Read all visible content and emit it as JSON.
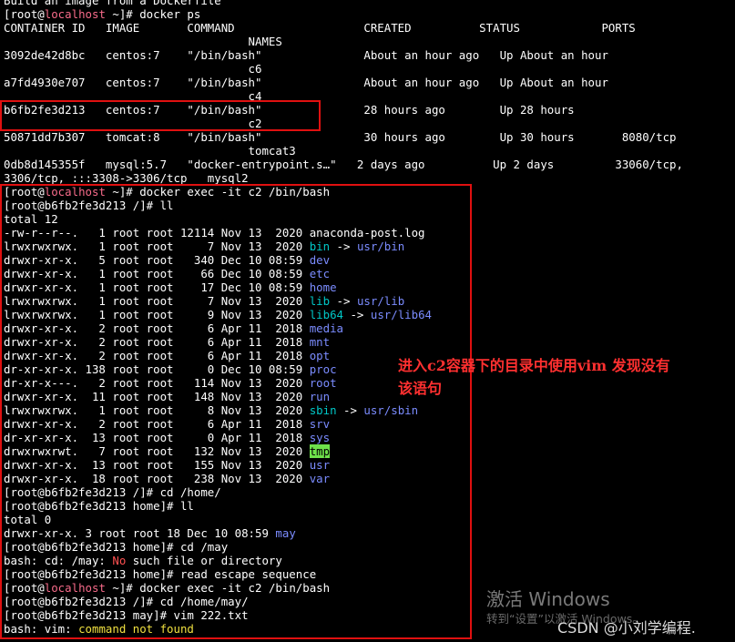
{
  "terminal": {
    "lines": [
      [
        {
          "t": "Build an image from a Dockerfile"
        }
      ],
      [
        {
          "t": "[root@"
        },
        {
          "t": "localhost",
          "c": "host"
        },
        {
          "t": " ~]# docker ps"
        }
      ],
      [
        {
          "t": "CONTAINER ID   IMAGE       COMMAND                   CREATED          STATUS            PORTS"
        }
      ],
      [
        {
          "t": "                                    NAMES"
        }
      ],
      [
        {
          "t": "3092de42d8bc   centos:7    \"/bin/bash\"               About an hour ago   Up About an hour"
        }
      ],
      [
        {
          "t": "                                    c6"
        }
      ],
      [
        {
          "t": "a7fd4930e707   centos:7    \"/bin/bash\"               About an hour ago   Up About an hour"
        }
      ],
      [
        {
          "t": "                                    c4"
        }
      ],
      [
        {
          "t": "b6fb2fe3d213   centos:7    \"/bin/bash\"               28 hours ago        Up 28 hours"
        }
      ],
      [
        {
          "t": "                                    c2"
        }
      ],
      [
        {
          "t": "50871dd7b307   tomcat:8    \"/bin/bash\"               30 hours ago        Up 30 hours       8080/tcp"
        }
      ],
      [
        {
          "t": "                                    tomcat3"
        }
      ],
      [
        {
          "t": "0db8d145355f   mysql:5.7   \"docker-entrypoint.s…\"   2 days ago          Up 2 days         33060/tcp,"
        }
      ],
      [
        {
          "t": "3306/tcp, :::3308->3306/tcp   mysql2"
        }
      ],
      [
        {
          "t": "[root@"
        },
        {
          "t": "localhost",
          "c": "host"
        },
        {
          "t": " ~]# docker exec -it c2 /bin/bash"
        }
      ],
      [
        {
          "t": "[root@b6fb2fe3d213 /]# ll"
        }
      ],
      [
        {
          "t": "total 12"
        }
      ],
      [
        {
          "t": "-rw-r--r--.   1 root root 12114 Nov 13  2020 anaconda-post.log"
        }
      ],
      [
        {
          "t": "lrwxrwxrwx.   1 root root     7 Nov 13  2020 "
        },
        {
          "t": "bin",
          "c": "link"
        },
        {
          "t": " -> "
        },
        {
          "t": "usr/bin",
          "c": "dir"
        }
      ],
      [
        {
          "t": "drwxr-xr-x.   5 root root   340 Dec 10 08:59 "
        },
        {
          "t": "dev",
          "c": "dir"
        }
      ],
      [
        {
          "t": "drwxr-xr-x.   1 root root    66 Dec 10 08:59 "
        },
        {
          "t": "etc",
          "c": "dir"
        }
      ],
      [
        {
          "t": "drwxr-xr-x.   1 root root    17 Dec 10 08:59 "
        },
        {
          "t": "home",
          "c": "dir"
        }
      ],
      [
        {
          "t": "lrwxrwxrwx.   1 root root     7 Nov 13  2020 "
        },
        {
          "t": "lib",
          "c": "link"
        },
        {
          "t": " -> "
        },
        {
          "t": "usr/lib",
          "c": "dir"
        }
      ],
      [
        {
          "t": "lrwxrwxrwx.   1 root root     9 Nov 13  2020 "
        },
        {
          "t": "lib64",
          "c": "link"
        },
        {
          "t": " -> "
        },
        {
          "t": "usr/lib64",
          "c": "dir"
        }
      ],
      [
        {
          "t": "drwxr-xr-x.   2 root root     6 Apr 11  2018 "
        },
        {
          "t": "media",
          "c": "dir"
        }
      ],
      [
        {
          "t": "drwxr-xr-x.   2 root root     6 Apr 11  2018 "
        },
        {
          "t": "mnt",
          "c": "dir"
        }
      ],
      [
        {
          "t": "drwxr-xr-x.   2 root root     6 Apr 11  2018 "
        },
        {
          "t": "opt",
          "c": "dir"
        }
      ],
      [
        {
          "t": "dr-xr-xr-x. 138 root root     0 Dec 10 08:59 "
        },
        {
          "t": "proc",
          "c": "dir"
        }
      ],
      [
        {
          "t": "dr-xr-x---.   2 root root   114 Nov 13  2020 "
        },
        {
          "t": "root",
          "c": "dir"
        }
      ],
      [
        {
          "t": "drwxr-xr-x.  11 root root   148 Nov 13  2020 "
        },
        {
          "t": "run",
          "c": "dir"
        }
      ],
      [
        {
          "t": "lrwxrwxrwx.   1 root root     8 Nov 13  2020 "
        },
        {
          "t": "sbin",
          "c": "link"
        },
        {
          "t": " -> "
        },
        {
          "t": "usr/sbin",
          "c": "dir"
        }
      ],
      [
        {
          "t": "drwxr-xr-x.   2 root root     6 Apr 11  2018 "
        },
        {
          "t": "srv",
          "c": "dir"
        }
      ],
      [
        {
          "t": "dr-xr-xr-x.  13 root root     0 Apr 11  2018 "
        },
        {
          "t": "sys",
          "c": "dir"
        }
      ],
      [
        {
          "t": "drwxrwxrwt.   7 root root   132 Nov 13  2020 "
        },
        {
          "t": "tmp",
          "c": "hl"
        }
      ],
      [
        {
          "t": "drwxr-xr-x.  13 root root   155 Nov 13  2020 "
        },
        {
          "t": "usr",
          "c": "dir"
        }
      ],
      [
        {
          "t": "drwxr-xr-x.  18 root root   238 Nov 13  2020 "
        },
        {
          "t": "var",
          "c": "dir"
        }
      ],
      [
        {
          "t": "[root@b6fb2fe3d213 /]# cd /home/"
        }
      ],
      [
        {
          "t": "[root@b6fb2fe3d213 home]# ll"
        }
      ],
      [
        {
          "t": "total 0"
        }
      ],
      [
        {
          "t": "drwxr-xr-x. 3 root root 18 Dec 10 08:59 "
        },
        {
          "t": "may",
          "c": "dir"
        }
      ],
      [
        {
          "t": "[root@b6fb2fe3d213 home]# cd /may"
        }
      ],
      [
        {
          "t": "bash: cd: /may: "
        },
        {
          "t": "No",
          "c": "red"
        },
        {
          "t": " such file or directory"
        }
      ],
      [
        {
          "t": "[root@b6fb2fe3d213 home]# read escape sequence"
        }
      ],
      [
        {
          "t": "[root@"
        },
        {
          "t": "localhost",
          "c": "host"
        },
        {
          "t": " ~]# docker exec -it c2 /bin/bash"
        }
      ],
      [
        {
          "t": "[root@b6fb2fe3d213 /]# cd /home/may/"
        }
      ],
      [
        {
          "t": "[root@b6fb2fe3d213 may]# vim 222.txt"
        }
      ],
      [
        {
          "t": "bash: vim: "
        },
        {
          "t": "command not found",
          "c": "yellow"
        }
      ]
    ]
  },
  "annotation": {
    "line1": "进入c2容器下的目录中使用vim 发现没有",
    "line2": "该语句"
  },
  "watermark": {
    "activate_title": "激活 Windows",
    "activate_sub": "转到“设置”以激活 Windows。",
    "csdn": "CSDN @小刘学编程."
  },
  "colors": {
    "background": "#000000",
    "text": "#ffffff",
    "hostname": "#f76b8a",
    "directory": "#7b8cff",
    "symlink": "#00c8c8",
    "highlight_bg": "#6ee04a",
    "error_yellow": "#f0e040",
    "annotation_red": "#ff3030",
    "box_border": "#e01010"
  }
}
